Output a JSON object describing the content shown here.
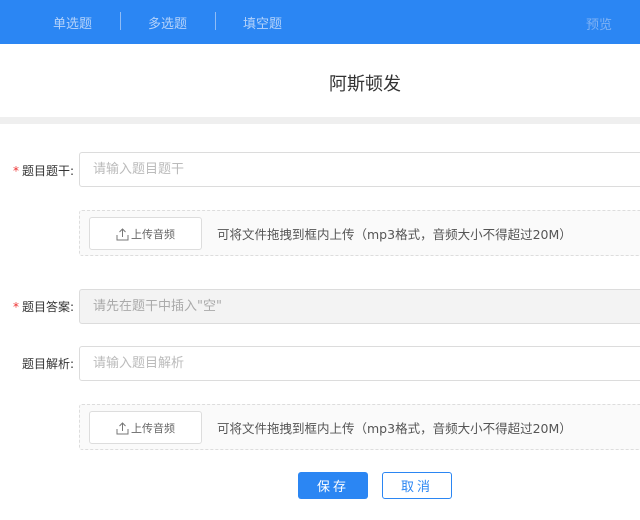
{
  "header": {
    "tabs": [
      {
        "label": "单选题"
      },
      {
        "label": "多选题"
      },
      {
        "label": "填空题"
      }
    ],
    "preview_label": "预览",
    "color": "#2b86f3"
  },
  "page_title": "阿斯顿发",
  "form": {
    "stem": {
      "label": "题目题干:",
      "required": "*",
      "placeholder": "请输入题目题干"
    },
    "upload1": {
      "button": "上传音频",
      "hint": "可将文件拖拽到框内上传（mp3格式，音频大小不得超过20M）"
    },
    "answer": {
      "label": "题目答案:",
      "required": "*",
      "placeholder": "请先在题干中插入\"空\""
    },
    "analysis": {
      "label": "题目解析:",
      "placeholder": "请输入题目解析"
    },
    "upload2": {
      "button": "上传音频",
      "hint": "可将文件拖拽到框内上传（mp3格式，音频大小不得超过20M）"
    }
  },
  "actions": {
    "save": "保存",
    "cancel": "取消"
  }
}
